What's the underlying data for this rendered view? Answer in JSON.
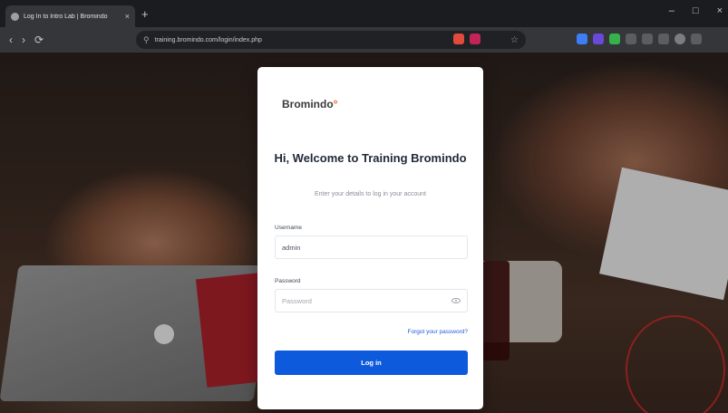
{
  "browser": {
    "tab_title": "Log In to Intro Lab | Bromindo",
    "tab_close": "×",
    "new_tab": "+",
    "window_controls": [
      "–",
      "□",
      "×"
    ],
    "nav": {
      "back": "‹",
      "forward": "›",
      "reload": "⟳"
    },
    "url": "training.bromindo.com/login/index.php"
  },
  "login": {
    "logo_text": "Bromindo",
    "heading": "Hi, Welcome to Training Bromindo",
    "subheading": "Enter your details to log in your account",
    "username_label": "Username",
    "username_value": "admin",
    "password_label": "Password",
    "password_placeholder": "Password",
    "forgot_link": "Forgot your password?",
    "login_button": "Log in"
  },
  "colors": {
    "primary": "#0d5bdc",
    "logo_accent": "#ef5b1e",
    "link": "#1d5bd8"
  }
}
